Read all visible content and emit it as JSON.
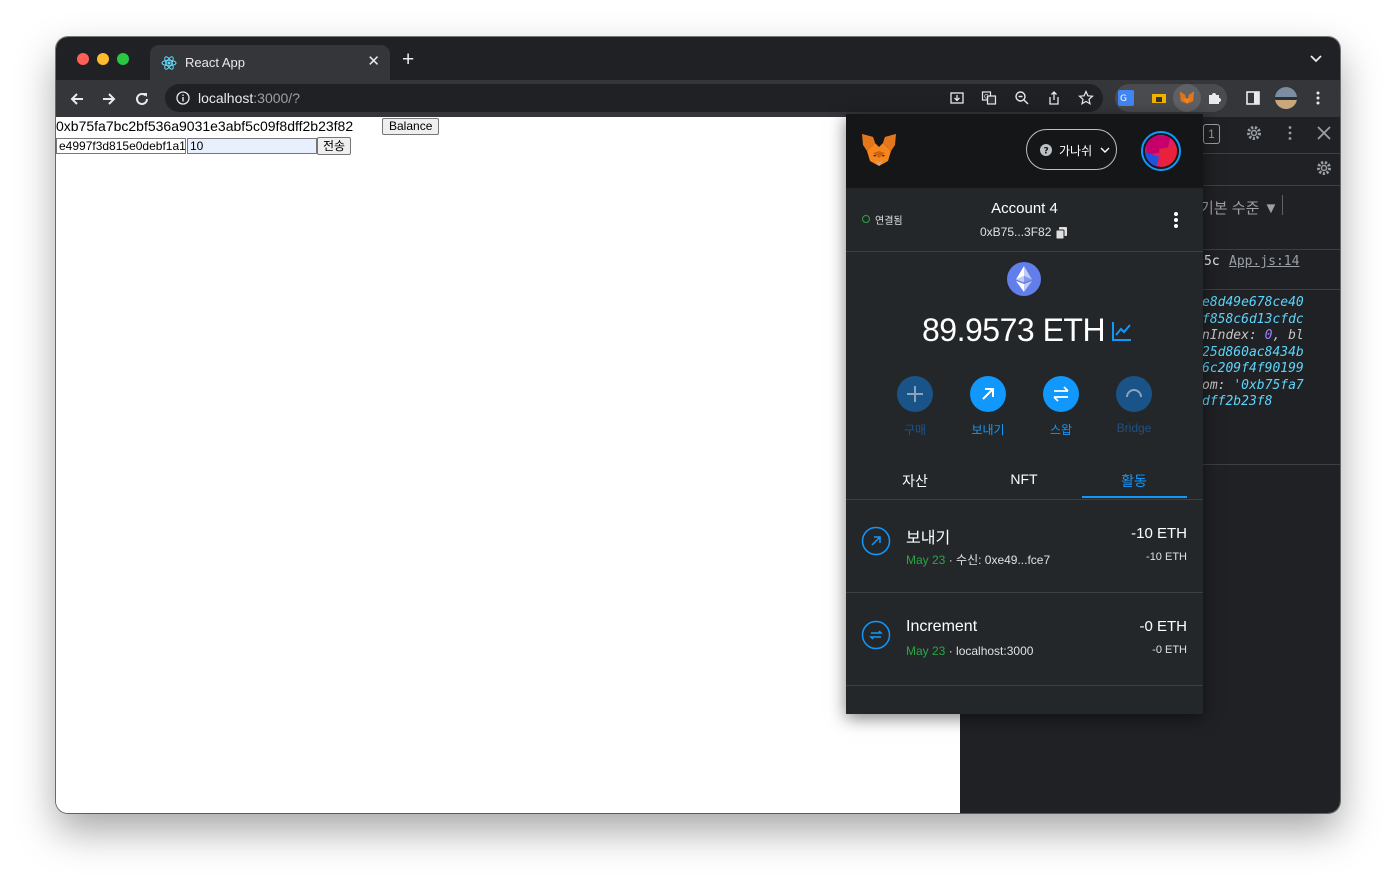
{
  "browser": {
    "tab_title": "React App",
    "url_host": "localhost",
    "url_rest": ":3000/?"
  },
  "page": {
    "address": "0xb75fa7bc2bf536a9031e3abf5c09f8dff2b23f82",
    "balance_button": "Balance",
    "to_input_value": "e4997f3d815e0debf1a1",
    "amount_input_value": "10",
    "send_button": "전송"
  },
  "devtools": {
    "tab_fragment": "1",
    "level_label": "기본 수준 ▼",
    "log_prefix": "5c",
    "log_source": "App.js:14",
    "log_lines": [
      "e8d49e678ce40",
      "f858c6d13cfdc",
      "nIndex: 0, bl",
      "25d860ac8434b",
      "6c209f4f90199",
      "om: '0xb75fa7",
      "dff2b23f8"
    ]
  },
  "metamask": {
    "network_label": "가나쉬",
    "connection_status": "연결됨",
    "account_name": "Account 4",
    "account_address": "0xB75...3F82",
    "balance": "89.9573 ETH",
    "actions": [
      {
        "label": "구매",
        "icon": "plus-icon",
        "enabled": false
      },
      {
        "label": "보내기",
        "icon": "arrow-up-right-icon",
        "enabled": true
      },
      {
        "label": "스왑",
        "icon": "swap-arrows-icon",
        "enabled": true
      },
      {
        "label": "Bridge",
        "icon": "bridge-icon",
        "enabled": false
      }
    ],
    "tabs": [
      "자산",
      "NFT",
      "활동"
    ],
    "active_tab": "활동",
    "transactions": [
      {
        "title": "보내기",
        "date": "May 23",
        "detail": "수신: 0xe49...fce7",
        "amount": "-10 ETH",
        "amount_secondary": "-10 ETH",
        "icon": "send-icon"
      },
      {
        "title": "Increment",
        "date": "May 23",
        "detail": "localhost:3000",
        "amount": "-0 ETH",
        "amount_secondary": "-0 ETH",
        "icon": "contract-interaction-icon"
      }
    ],
    "colors": {
      "accent": "#1098fc",
      "success": "#28a745",
      "background": "#24272a"
    }
  }
}
